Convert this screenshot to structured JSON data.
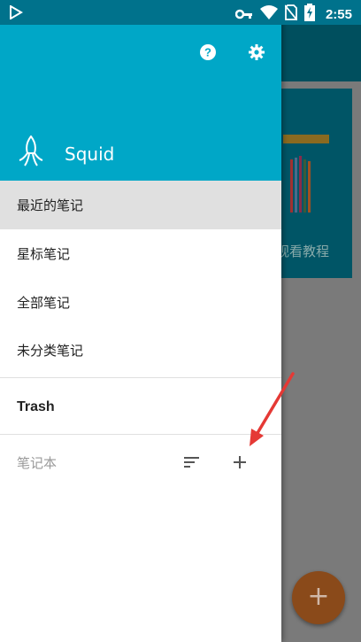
{
  "status_bar": {
    "time": "2:55",
    "icons": [
      "play-store-icon",
      "key-icon",
      "wifi-icon",
      "no-sim-icon",
      "battery-charging-icon"
    ]
  },
  "drawer": {
    "app_name": "Squid",
    "header_icons": [
      "help-icon",
      "settings-icon"
    ],
    "items": [
      {
        "label": "最近的笔记",
        "active": true
      },
      {
        "label": "星标笔记"
      },
      {
        "label": "全部笔记"
      },
      {
        "label": "未分类笔记"
      }
    ],
    "trash_label": "Trash",
    "notebooks_label": "笔记本",
    "notebook_actions": [
      "sort-icon",
      "add-icon"
    ]
  },
  "background": {
    "tutorial_text": "观看教程",
    "fab_label": "+"
  },
  "colors": {
    "header": "#00a7c7",
    "status_bar": "#00728c",
    "active_item": "#e0e0e0",
    "annotation_arrow": "#e53935"
  }
}
